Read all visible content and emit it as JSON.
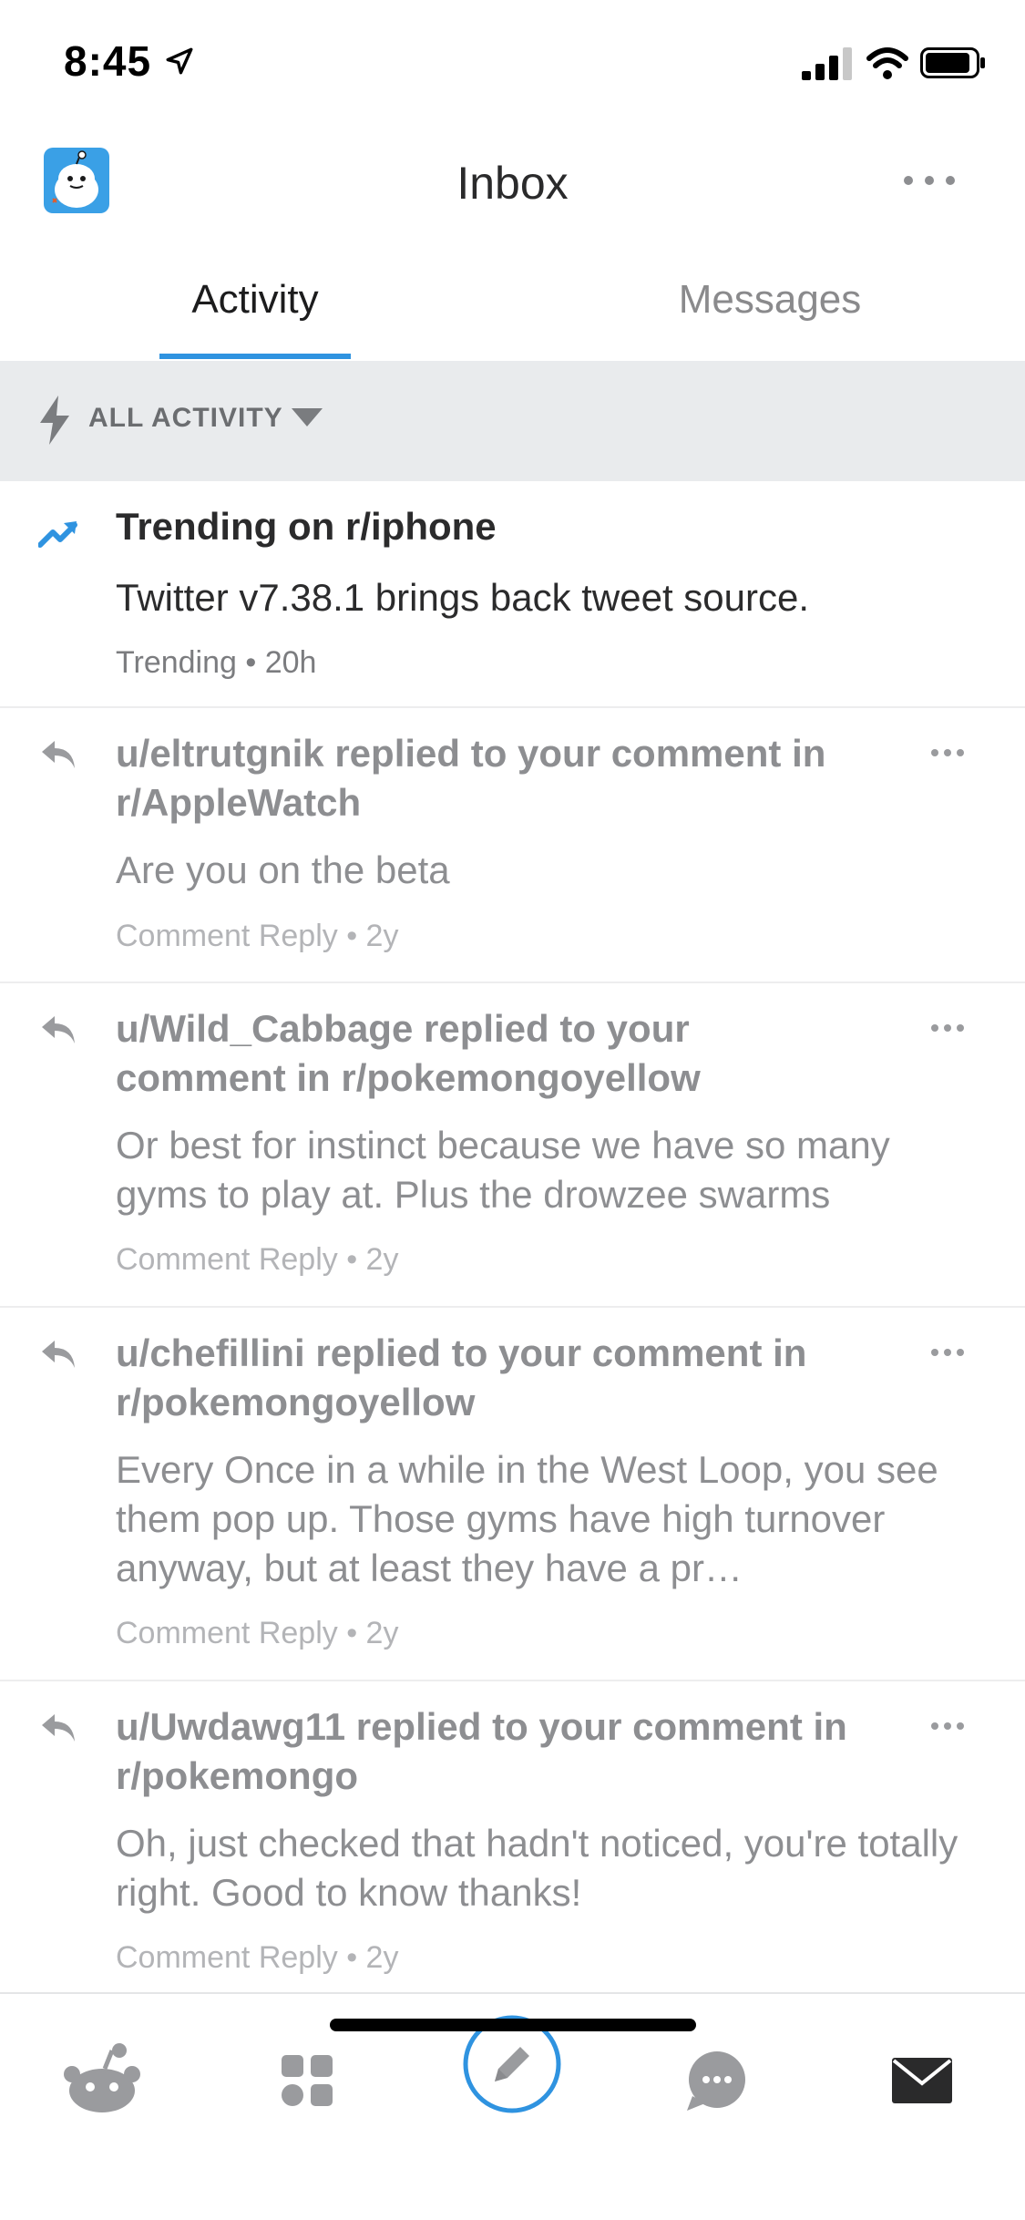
{
  "status_bar": {
    "time": "8:45",
    "icons": [
      "location-arrow-icon",
      "signal-icon",
      "wifi-icon",
      "battery-icon"
    ]
  },
  "header": {
    "title": "Inbox",
    "avatar_icon": "snoo-avatar-icon",
    "more_icon": "more-horizontal-icon"
  },
  "tabs": [
    {
      "label": "Activity",
      "active": true
    },
    {
      "label": "Messages",
      "active": false
    }
  ],
  "filter": {
    "label": "ALL ACTIVITY",
    "icon": "bolt-icon",
    "dropdown_icon": "caret-down-icon"
  },
  "items": [
    {
      "type": "trending",
      "icon": "trending-up-icon",
      "title": "Trending on r/iphone",
      "body": "Twitter v7.38.1 brings back tweet source.",
      "meta": "Trending • 20h"
    },
    {
      "type": "reply",
      "icon": "reply-icon",
      "title": "u/eltrutgnik replied to your comment in r/AppleWatch",
      "body": "Are you on the beta",
      "meta": "Comment Reply • 2y"
    },
    {
      "type": "reply",
      "icon": "reply-icon",
      "title": "u/Wild_Cabbage replied to your comment in r/pokemongoyellow",
      "body": "Or best for instinct because we have so many gyms to play at. Plus the drowzee swarms",
      "meta": "Comment Reply • 2y"
    },
    {
      "type": "reply",
      "icon": "reply-icon",
      "title": "u/chefillini replied to your comment in r/pokemongoyellow",
      "body": "Every Once in a while in the West Loop, you see them pop up. Those gyms have high turnover anyway, but at least they have a pr…",
      "meta": "Comment Reply • 2y"
    },
    {
      "type": "reply",
      "icon": "reply-icon",
      "title": "u/Uwdawg11 replied to your comment in r/pokemongo",
      "body": "Oh, just checked that hadn't noticed, you're totally right. Good to know thanks!",
      "meta": "Comment Reply • 2y"
    }
  ],
  "bottom_nav": [
    {
      "name": "home",
      "icon": "reddit-home-icon"
    },
    {
      "name": "communities",
      "icon": "communities-grid-icon"
    },
    {
      "name": "post",
      "icon": "pencil-icon"
    },
    {
      "name": "chat",
      "icon": "chat-bubble-icon"
    },
    {
      "name": "inbox",
      "icon": "mail-icon"
    }
  ],
  "colors": {
    "accent": "#2f93e0",
    "active_text": "#1c1c1d",
    "muted_text": "#8d8e91",
    "filter_bg": "#e9ebed"
  }
}
